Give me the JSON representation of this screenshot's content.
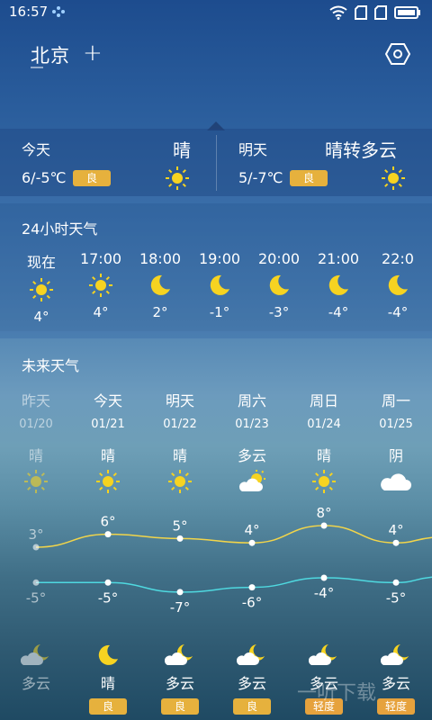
{
  "status": {
    "time": "16:57"
  },
  "header": {
    "city": "北京",
    "add_symbol": "+"
  },
  "today": {
    "label": "今天",
    "weather": "晴",
    "temp": "6/-5℃",
    "aqi": "良"
  },
  "tomorrow": {
    "label": "明天",
    "weather": "晴转多云",
    "temp": "5/-7℃",
    "aqi": "良"
  },
  "hourly": {
    "title": "24小时天气",
    "items": [
      {
        "time": "现在",
        "icon": "sun-icon",
        "temp": "4°"
      },
      {
        "time": "17:00",
        "icon": "sun-icon",
        "temp": "4°"
      },
      {
        "time": "18:00",
        "icon": "moon-icon",
        "temp": "2°"
      },
      {
        "time": "19:00",
        "icon": "moon-icon",
        "temp": "-1°"
      },
      {
        "time": "20:00",
        "icon": "moon-icon",
        "temp": "-3°"
      },
      {
        "time": "21:00",
        "icon": "moon-icon",
        "temp": "-4°"
      },
      {
        "time": "22:0",
        "icon": "moon-icon",
        "temp": "-4°"
      }
    ]
  },
  "forecast": {
    "title": "未来天气",
    "days": [
      {
        "name": "昨天",
        "date": "01/20",
        "weather": "晴",
        "icon": "sun-icon",
        "high": "3°",
        "low": "-5°",
        "night_icon": "cloudy-moon-icon",
        "night_weather": "多云",
        "aqi": ""
      },
      {
        "name": "今天",
        "date": "01/21",
        "weather": "晴",
        "icon": "sun-icon",
        "high": "6°",
        "low": "-5°",
        "night_icon": "moon-icon",
        "night_weather": "晴",
        "aqi": "良"
      },
      {
        "name": "明天",
        "date": "01/22",
        "weather": "晴",
        "icon": "sun-icon",
        "high": "5°",
        "low": "-7°",
        "night_icon": "cloudy-moon-icon",
        "night_weather": "多云",
        "aqi": "良"
      },
      {
        "name": "周六",
        "date": "01/23",
        "weather": "多云",
        "icon": "partly-cloudy-icon",
        "high": "4°",
        "low": "-6°",
        "night_icon": "cloudy-moon-icon",
        "night_weather": "多云",
        "aqi": "良"
      },
      {
        "name": "周日",
        "date": "01/24",
        "weather": "晴",
        "icon": "sun-icon",
        "high": "8°",
        "low": "-4°",
        "night_icon": "cloudy-moon-icon",
        "night_weather": "多云",
        "aqi": "轻度"
      },
      {
        "name": "周一",
        "date": "01/25",
        "weather": "阴",
        "icon": "cloud-icon",
        "high": "4°",
        "low": "-5°",
        "night_icon": "cloudy-moon-icon",
        "night_weather": "多云",
        "aqi": "轻度"
      }
    ],
    "high_values": [
      3,
      6,
      5,
      4,
      8,
      4
    ],
    "low_values": [
      -5,
      -5,
      -7,
      -6,
      -4,
      -5
    ]
  },
  "colors": {
    "badge_good": "#e6b13d",
    "badge_light": "#e6a23d",
    "high_line": "#f2d54a",
    "low_line": "#4fd9e0"
  },
  "watermark": "一听下载"
}
